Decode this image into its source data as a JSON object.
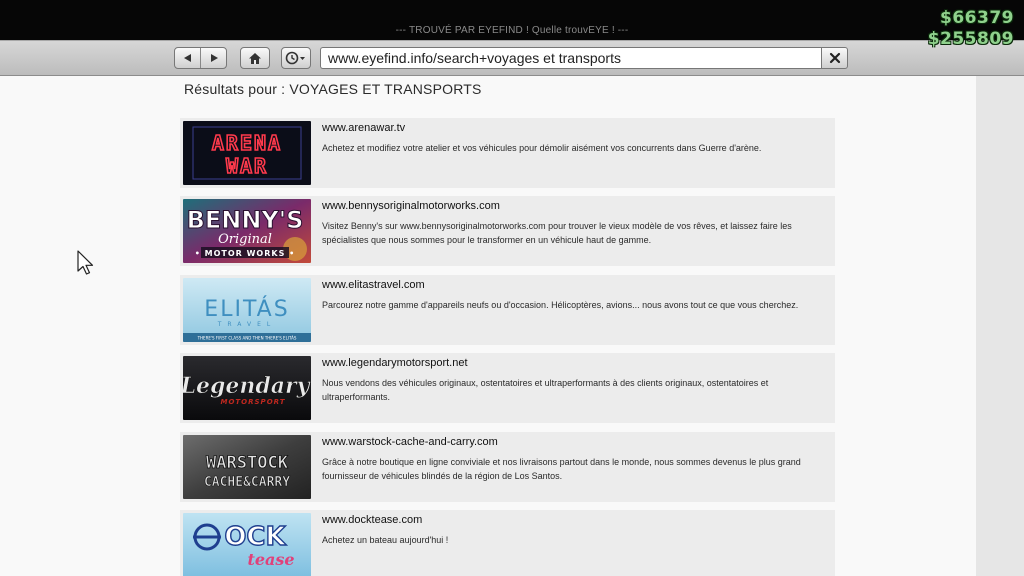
{
  "window": {
    "title": "--- TROUVÉ PAR EYEFIND ! Quelle trouvEYE ! ---"
  },
  "hud": {
    "cash": "$66379",
    "bank": "$255809",
    "color": "#8fd18c"
  },
  "toolbar": {
    "back_icon": "back-arrow-icon",
    "forward_icon": "forward-arrow-icon",
    "home_icon": "home-icon",
    "history_icon": "clock-icon",
    "address": "www.eyefind.info/search+voyages et transports",
    "clear_icon": "close-icon"
  },
  "page": {
    "results_heading": "Résultats pour : VOYAGES ET TRANSPORTS"
  },
  "results": [
    {
      "url": "www.arenawar.tv",
      "description": "Achetez et modifiez votre atelier et vos véhicules pour démolir aisément vos concurrents dans Guerre d'arène.",
      "logo": "ARENA WAR"
    },
    {
      "url": "www.bennysoriginalmotorworks.com",
      "description": "Visitez Benny's sur www.bennysoriginalmotorworks.com pour trouver le vieux modèle de vos rêves, et laissez faire les spécialistes que nous sommes pour le transformer en un véhicule haut de gamme.",
      "logo": "BENNY'S Original MOTOR WORKS"
    },
    {
      "url": "www.elitastravel.com",
      "description": "Parcourez notre gamme d'appareils neufs ou d'occasion. Hélicoptères, avions... nous avons tout ce que vous cherchez.",
      "logo": "ELITÁS TRAVEL THERE'S FIRST CLASS AND THEN THERE'S ELITÁS"
    },
    {
      "url": "www.legendarymotorsport.net",
      "description": "Nous vendons des véhicules originaux, ostentatoires et ultraperformants à des clients originaux, ostentatoires et ultraperformants.",
      "logo": "Legendary MOTORSPORT"
    },
    {
      "url": "www.warstock-cache-and-carry.com",
      "description": "Grâce à notre boutique en ligne conviviale et nos livraisons partout dans le monde, nous sommes devenus le plus grand fournisseur de véhicules blindés de la région de Los Santos.",
      "logo": "WARSTOCK CACHE&CARRY"
    },
    {
      "url": "www.docktease.com",
      "description": "Achetez un bateau aujourd'hui !",
      "logo": "DOCK tease"
    }
  ]
}
